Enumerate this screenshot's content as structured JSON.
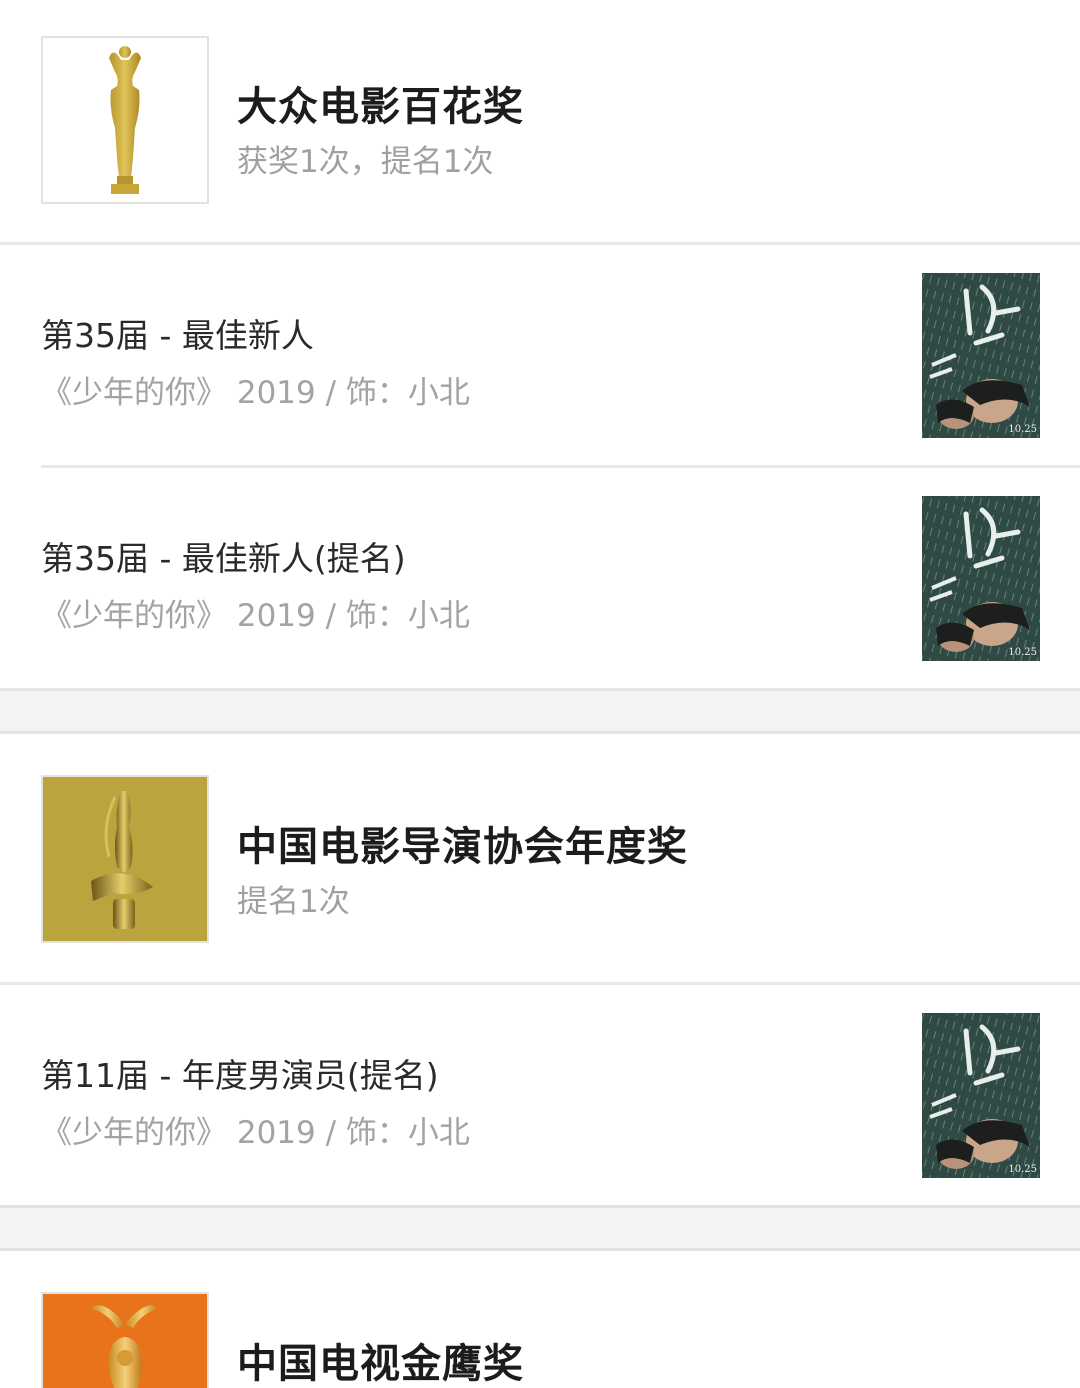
{
  "awards": [
    {
      "name": "大众电影百花奖",
      "summary": "获奖1次，提名1次",
      "logo_icon": "golden-trophy-figure",
      "logo_bg": "#ffffff",
      "entries": [
        {
          "title": "第35届 - 最佳新人",
          "detail": "《少年的你》 2019 / 饰：小北",
          "poster_icon": "movie-poster"
        },
        {
          "title": "第35届 - 最佳新人(提名)",
          "detail": "《少年的你》 2019 / 饰：小北",
          "poster_icon": "movie-poster"
        }
      ]
    },
    {
      "name": "中国电影导演协会年度奖",
      "summary": "提名1次",
      "logo_icon": "golden-statue-on-fish",
      "logo_bg": "#b9a33c",
      "entries": [
        {
          "title": "第11届 - 年度男演员(提名)",
          "detail": "《少年的你》 2019 / 饰：小北",
          "poster_icon": "movie-poster"
        }
      ]
    },
    {
      "name": "中国电视金鹰奖",
      "summary": "",
      "logo_icon": "golden-eagle-trophy",
      "logo_bg": "#e8731a",
      "entries": []
    }
  ],
  "poster_text": {
    "date": "10.25"
  }
}
